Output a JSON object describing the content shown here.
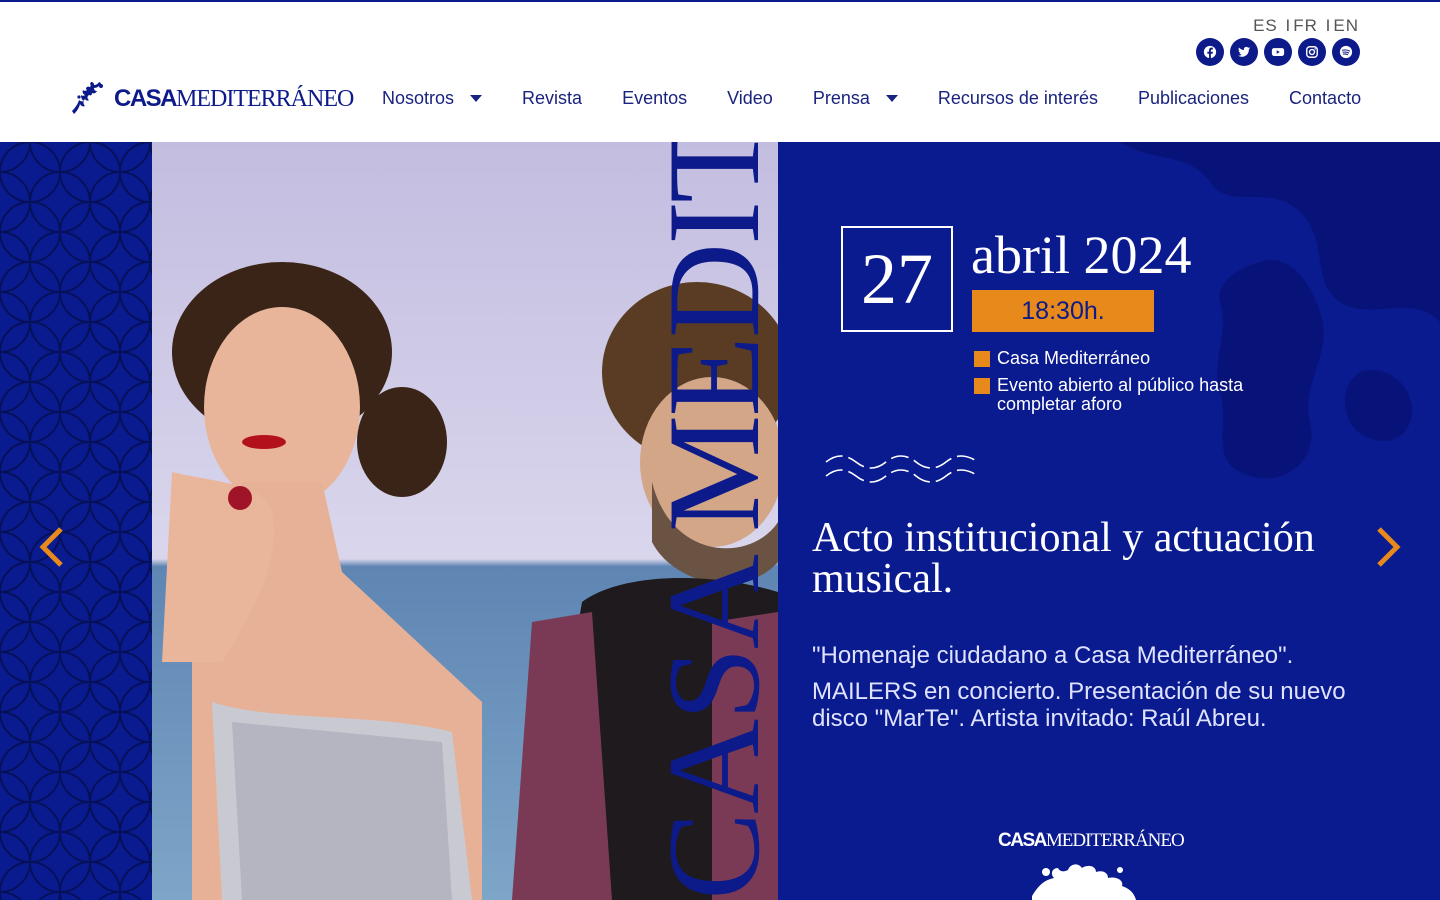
{
  "header": {
    "languages": [
      "ES",
      "FR",
      "EN"
    ],
    "lang_separator": "I",
    "logo": {
      "bold": "CASA",
      "rest": "MEDITERRÁNEO"
    },
    "socials": [
      "facebook-icon",
      "twitter-icon",
      "youtube-icon",
      "instagram-icon",
      "spotify-icon"
    ],
    "nav": [
      {
        "label": "Nosotros",
        "dropdown": true
      },
      {
        "label": "Revista",
        "dropdown": false
      },
      {
        "label": "Eventos",
        "dropdown": false
      },
      {
        "label": "Video",
        "dropdown": false
      },
      {
        "label": "Prensa",
        "dropdown": true
      },
      {
        "label": "Recursos de interés",
        "dropdown": false
      },
      {
        "label": "Publicaciones",
        "dropdown": false
      },
      {
        "label": "Contacto",
        "dropdown": false
      }
    ]
  },
  "slide": {
    "vertical_title": "CASA MEDITERRÁNEO",
    "day": "27",
    "month_year": "abril 2024",
    "time": "18:30h.",
    "location": "Casa Mediterráneo",
    "access": "Evento abierto al público hasta completar aforo",
    "headline": "Acto institucional y actuación musical.",
    "desc1": "\"Homenaje ciudadano a Casa Mediterráneo\".",
    "desc2": "MAILERS en concierto. Presentación de su nuevo disco \"MarTe\". Artista invitado: Raúl Abreu.",
    "footer_logo": {
      "bold": "CASA",
      "rest": "MEDITERRÁNEO"
    }
  },
  "colors": {
    "brand_blue": "#0a1a8f",
    "nav_text": "#1a237e",
    "accent_orange": "#e8891c"
  }
}
